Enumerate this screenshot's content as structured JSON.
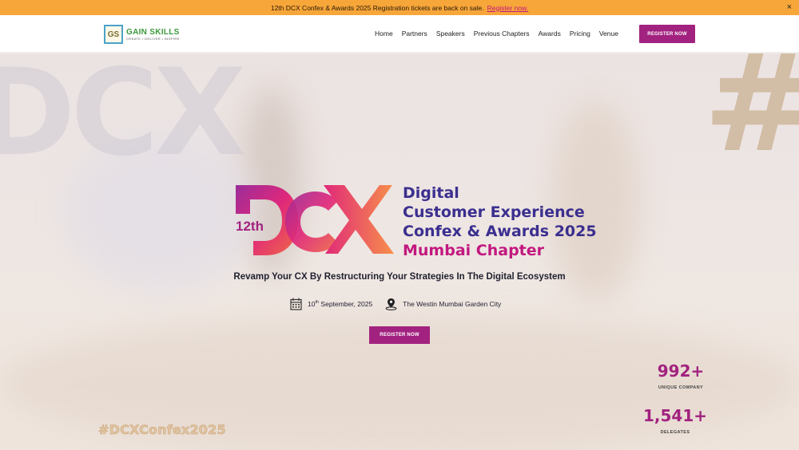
{
  "announcement": {
    "text": "12th DCX Confex & Awards 2025 Registration tickets are back on sale.",
    "link": "Register now.",
    "close": "×"
  },
  "header": {
    "logo": {
      "mark": "GS",
      "name": "GAIN SKILLS",
      "tagline": "CREATE • DELIVER • INSPIRE"
    },
    "nav": [
      "Home",
      "Partners",
      "Speakers",
      "Previous Chapters",
      "Awards",
      "Pricing",
      "Venue"
    ],
    "cta": "REGISTER NOW"
  },
  "hero": {
    "background_text": "DCX",
    "background_hash": "#",
    "edition": "12th",
    "mark_text": "DCX",
    "title_lines": [
      "Digital",
      "Customer Experience",
      "Confex & Awards 2025"
    ],
    "chapter": "Mumbai Chapter",
    "tagline": "Revamp Your CX By Restructuring Your Strategies In The Digital Ecosystem",
    "date_day": "10",
    "date_suffix": "th",
    "date_rest": " September, 2025",
    "venue": "The Westin Mumbai Garden City",
    "cta": "REGISTER NOW",
    "hashtag": "#DCXConfex2025",
    "stats": [
      {
        "value": "992+",
        "label": "UNIQUE COMPANY"
      },
      {
        "value": "1,541+",
        "label": "DELEGATES"
      }
    ]
  },
  "colors": {
    "accent": "#a2227f",
    "announce_bg": "#f7a63a",
    "title": "#3b2f8f",
    "chapter": "#c2187f"
  },
  "icons": [
    "close-icon",
    "calendar-icon",
    "location-pin-icon"
  ]
}
